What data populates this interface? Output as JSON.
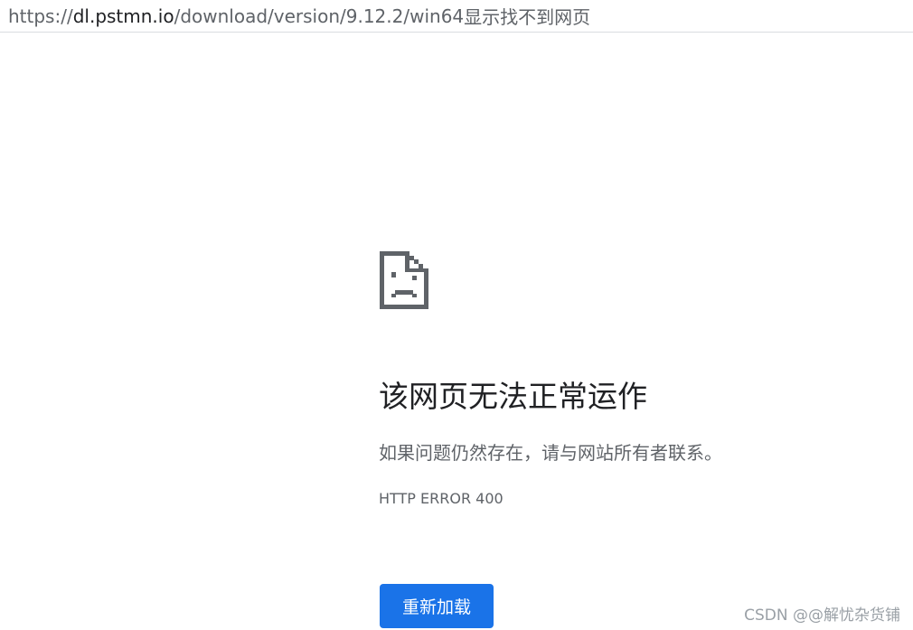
{
  "address_bar": {
    "scheme": "https://",
    "host": "dl.pstmn.io",
    "path": "/download/version/9.12.2/win64",
    "annotation": "显示找不到网页"
  },
  "error": {
    "icon": "sad-page-icon",
    "title": "该网页无法正常运作",
    "message": "如果问题仍然存在，请与网站所有者联系。",
    "code": "HTTP ERROR 400",
    "reload_label": "重新加载"
  },
  "watermark": "CSDN @@解忧杂货铺",
  "colors": {
    "accent": "#1a73e8",
    "title": "#202124",
    "secondary": "#5f6368"
  }
}
